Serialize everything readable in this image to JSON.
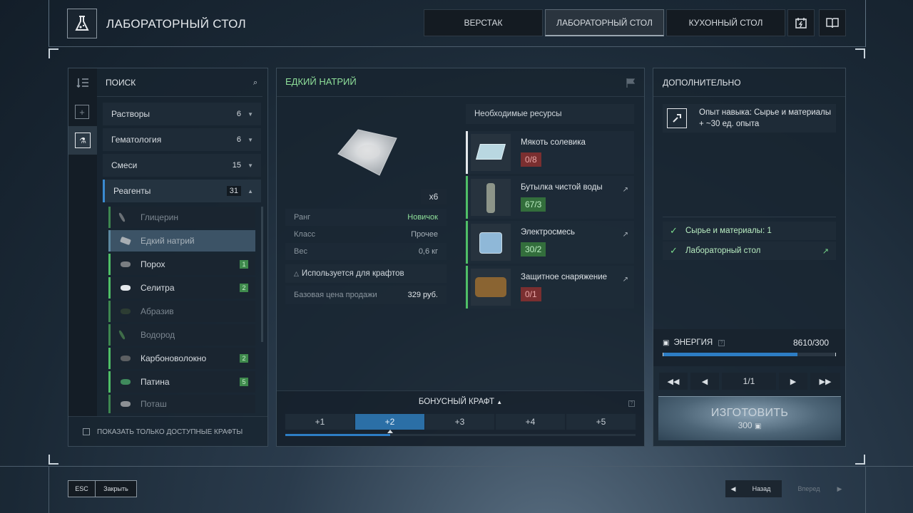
{
  "header": {
    "title": "ЛАБОРАТОРНЫЙ СТОЛ",
    "tabs": [
      {
        "label": "ВЕРСТАК"
      },
      {
        "label": "ЛАБОРАТОРНЫЙ СТОЛ"
      },
      {
        "label": "КУХОННЫЙ СТОЛ"
      }
    ],
    "active_tab": "ЛАБОРАТОРНЫЙ СТОЛ",
    "icons": [
      "energy-calendar-icon",
      "book-icon"
    ]
  },
  "left_panel": {
    "search_label": "ПОИСК",
    "categories": [
      {
        "label": "Растворы",
        "count": "6"
      },
      {
        "label": "Гематология",
        "count": "6"
      },
      {
        "label": "Смеси",
        "count": "15"
      },
      {
        "label": "Реагенты",
        "count": "31"
      }
    ],
    "items": [
      {
        "label": "Глицерин",
        "available": false,
        "badge": ""
      },
      {
        "label": "Едкий натрий",
        "available": false,
        "badge": "",
        "selected": true
      },
      {
        "label": "Порох",
        "available": true,
        "badge": "1"
      },
      {
        "label": "Селитра",
        "available": true,
        "badge": "2"
      },
      {
        "label": "Абразив",
        "available": false,
        "badge": ""
      },
      {
        "label": "Водород",
        "available": false,
        "badge": ""
      },
      {
        "label": "Карбоноволокно",
        "available": true,
        "badge": "2"
      },
      {
        "label": "Патина",
        "available": true,
        "badge": "5"
      },
      {
        "label": "Поташ",
        "available": false,
        "badge": ""
      }
    ],
    "filter_label": "ПОКАЗАТЬ ТОЛЬКО ДОСТУПНЫЕ КРАФТЫ"
  },
  "center_panel": {
    "item_name": "ЕДКИЙ НАТРИЙ",
    "quantity": "x6",
    "stats": [
      {
        "label": "Ранг",
        "value": "Новичок"
      },
      {
        "label": "Класс",
        "value": "Прочее"
      },
      {
        "label": "Вес",
        "value": "0,6 кг"
      }
    ],
    "used_for": "Используется для крафтов",
    "price_label": "Базовая цена продажи",
    "price_value": "329 руб.",
    "resources_title": "Необходимые ресурсы",
    "resources": [
      {
        "name": "Мякоть солевика",
        "qty": "0/8",
        "ok": false
      },
      {
        "name": "Бутылка чистой воды",
        "qty": "67/3",
        "ok": true
      },
      {
        "name": "Электросмесь",
        "qty": "30/2",
        "ok": true
      },
      {
        "name": "Защитное снаряжение",
        "qty": "0/1",
        "ok": false
      }
    ],
    "bonus_label": "БОНУСНЫЙ КРАФТ",
    "bonus_options": [
      "+1",
      "+2",
      "+3",
      "+4",
      "+5"
    ],
    "bonus_selected": "+2"
  },
  "right_panel": {
    "title": "ДОПОЛНИТЕЛЬНО",
    "skill_line1": "Опыт навыка: Сырье и материалы",
    "skill_line2": "+ ~30 ед. опыта",
    "requirements": [
      {
        "label": "Сырье и материалы: 1"
      },
      {
        "label": "Лабораторный стол"
      }
    ],
    "energy_label": "ЭНЕРГИЯ",
    "energy_value": "8610/300",
    "energy_fill": 0.78,
    "page": "1/1",
    "craft_label": "ИЗГОТОВИТЬ",
    "craft_cost": "300"
  },
  "footer": {
    "esc": "ESC",
    "close": "Закрыть",
    "back": "Назад",
    "forward": "Вперед"
  },
  "colors": {
    "accent_green": "#8fe09a",
    "bar_blue": "#2d7dc4",
    "bad_red": "#7a2f30"
  }
}
